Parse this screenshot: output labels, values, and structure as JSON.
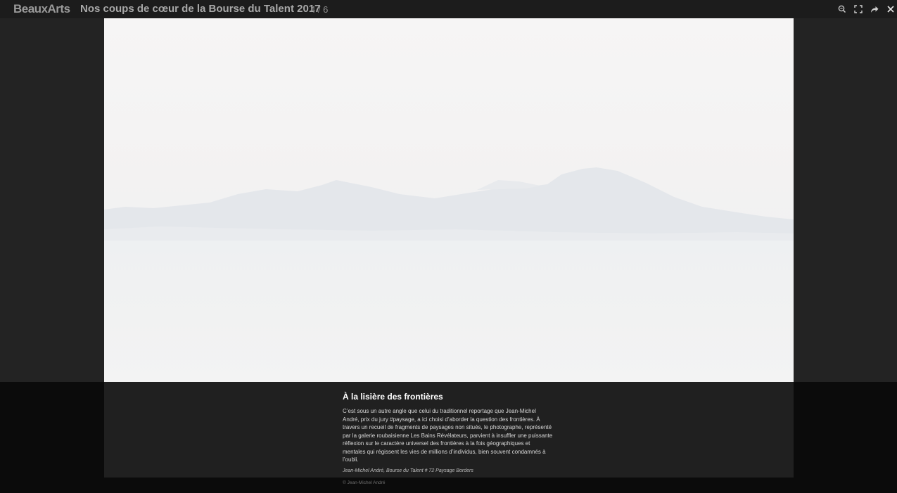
{
  "header": {
    "brand": "BeauxArts",
    "gallery_title": "Nos coups de cœur de la Bourse du Talent 2017",
    "counter": "4 / 6"
  },
  "toolbar": {
    "buttons": [
      {
        "name": "zoom",
        "icon": "zoom-icon"
      },
      {
        "name": "fullscreen",
        "icon": "fullscreen-icon"
      },
      {
        "name": "share",
        "icon": "share-icon"
      },
      {
        "name": "close",
        "icon": "close-icon"
      }
    ]
  },
  "caption": {
    "heading": "À la lisière des frontières",
    "body": "C’est sous un autre angle que celui du traditionnel reportage que Jean-Michel André, prix du jury #paysage, a ici choisi d’aborder la question des frontières. À travers un recueil de fragments de paysages non situés, le photographe, représenté par la galerie roubaisienne Les Bains Révélateurs, parvient à insuffler une puissante réflexion sur le caractère universel des frontières à la fois géographiques et mentales qui régissent les vies de millions d’individus, bien souvent condamnés à l’oubli.",
    "credit": "Jean-Michel André, Bourse du Talent # 72 Paysage Borders",
    "copyright": "© Jean-Michel André"
  },
  "colors": {
    "background": "#1f1f1f",
    "caption_band": "#0b0b0b",
    "caption_panel": "#202020"
  }
}
